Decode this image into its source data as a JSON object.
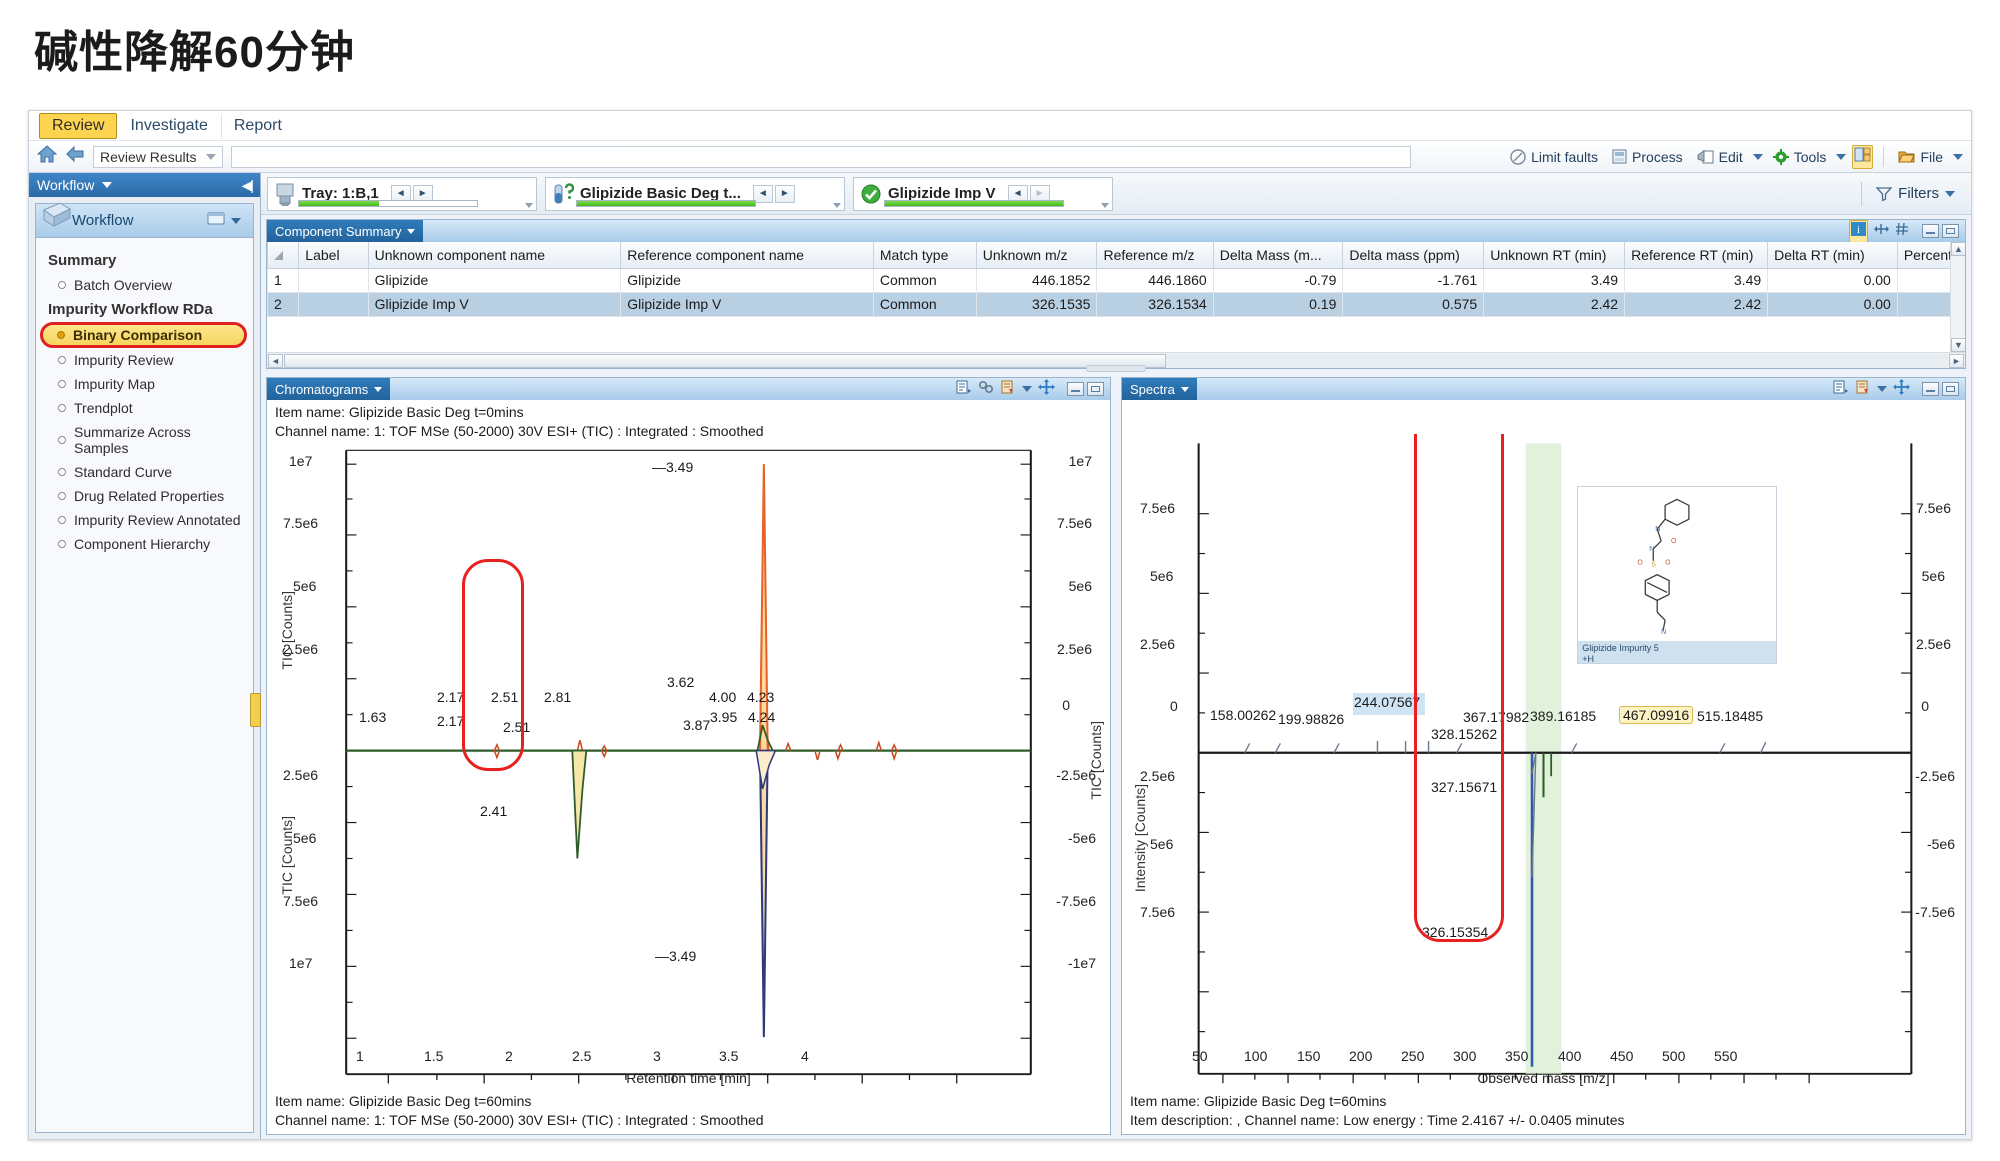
{
  "slide": {
    "title": "碱性降解60分钟"
  },
  "ribbon": {
    "tabs": [
      {
        "label": "Review",
        "active": true
      },
      {
        "label": "Investigate",
        "active": false
      },
      {
        "label": "Report",
        "active": false
      }
    ]
  },
  "toolbar": {
    "home_icon": "home-icon",
    "back_icon": "back-arrow-icon",
    "breadcrumb": "Review Results",
    "items": [
      {
        "label": "Limit faults",
        "icon": "limit-faults-icon",
        "caret": false
      },
      {
        "label": "Process",
        "icon": "process-icon",
        "caret": false
      },
      {
        "label": "Edit",
        "icon": "edit-icon",
        "caret": true
      },
      {
        "label": "Tools",
        "icon": "gear-icon",
        "caret": true
      },
      {
        "label": "File",
        "icon": "folder-icon",
        "caret": true
      }
    ]
  },
  "sidebar": {
    "header": "Workflow",
    "card_title": "Workflow",
    "groups": [
      {
        "title": "Summary",
        "items": [
          {
            "label": "Batch Overview",
            "selected": false
          }
        ]
      },
      {
        "title": "Impurity Workflow RDa",
        "items": [
          {
            "label": "Binary Comparison",
            "selected": true
          },
          {
            "label": "Impurity Review",
            "selected": false
          },
          {
            "label": "Impurity Map",
            "selected": false
          },
          {
            "label": "Trendplot",
            "selected": false
          },
          {
            "label": "Summarize Across Samples",
            "selected": false
          },
          {
            "label": "Standard Curve",
            "selected": false
          },
          {
            "label": "Drug Related Properties",
            "selected": false
          },
          {
            "label": "Impurity Review Annotated",
            "selected": false
          },
          {
            "label": "Component Hierarchy",
            "selected": false
          }
        ]
      }
    ]
  },
  "navbar": {
    "boxes": [
      {
        "title": "Tray: 1:B,1",
        "icon": "tray-icon",
        "progress": 45
      },
      {
        "title": "Glipizide Basic Deg t...",
        "icon": "sample-icon",
        "progress": 100
      },
      {
        "title": "Glipizide Imp V",
        "icon": "check-icon",
        "progress": 100
      }
    ],
    "filters_label": "Filters",
    "filters_icon": "funnel-icon"
  },
  "component_summary": {
    "title": "Component Summary",
    "columns": [
      "Label",
      "Unknown component name",
      "Reference component name",
      "Match type",
      "Unknown m/z",
      "Reference m/z",
      "Delta Mass (m...",
      "Delta mass (ppm)",
      "Unknown RT (min)",
      "Reference RT (min)",
      "Delta RT (min)",
      "Percent"
    ],
    "rows": [
      {
        "index": "1",
        "selected": false,
        "cells": [
          "",
          "Glipizide",
          "Glipizide",
          "Common",
          "446.1852",
          "446.1860",
          "-0.79",
          "-1.761",
          "3.49",
          "3.49",
          "0.00",
          ""
        ]
      },
      {
        "index": "2",
        "selected": true,
        "cells": [
          "",
          "Glipizide Imp V",
          "Glipizide Imp V",
          "Common",
          "326.1535",
          "326.1534",
          "0.19",
          "0.575",
          "2.42",
          "2.42",
          "0.00",
          ""
        ]
      }
    ]
  },
  "chart_data": [
    {
      "type": "line",
      "panel_title": "Chromatograms",
      "header_lines": [
        "Item name: Glipizide Basic Deg t=0mins",
        "Channel name: 1: TOF MSe (50-2000) 30V ESI+ (TIC) : Integrated : Smoothed"
      ],
      "footer_lines": [
        "Item name: Glipizide Basic Deg t=60mins",
        "Channel name: 1: TOF MSe (50-2000) 30V ESI+ (TIC) : Integrated : Smoothed"
      ],
      "xlabel": "Retention time [min]",
      "ylabel": "TIC [Counts]",
      "ylabel_right": "TIC [Counts]",
      "xticks": [
        "1",
        "1.5",
        "2",
        "2.5",
        "3",
        "3.5",
        "4"
      ],
      "xlim": [
        0.78,
        4.42
      ],
      "yticks_upper": [
        "1e7",
        "7.5e6",
        "5e6",
        "2.5e6"
      ],
      "yticks_lower": [
        "2.5e6",
        "5e6",
        "7.5e6",
        "1e7"
      ],
      "yticks_right_upper": [
        "1e7",
        "7.5e6",
        "5e6",
        "2.5e6",
        "0"
      ],
      "yticks_right_lower": [
        "-2.5e6",
        "-5e6",
        "-7.5e6",
        "-1e7"
      ],
      "zero_label": "0",
      "mirrored": true,
      "grid": false,
      "upper_peaks": [
        {
          "rt": 1.63,
          "label": "1.63",
          "height": 0.004
        },
        {
          "rt": 2.17,
          "label": "2.17",
          "height": 0.006
        },
        {
          "rt": 2.51,
          "label": "2.51",
          "height": 0.008
        },
        {
          "rt": 2.81,
          "label": "2.81",
          "height": 0.004
        },
        {
          "rt": 3.49,
          "label": "3.49",
          "height": 1.0
        },
        {
          "rt": 3.62,
          "label": "3.62",
          "height": 0.02
        },
        {
          "rt": 4.0,
          "label": "4.00",
          "height": 0.01
        },
        {
          "rt": 4.23,
          "label": "4.23",
          "height": 0.01
        }
      ],
      "lower_peaks": [
        {
          "rt": 2.17,
          "label": "2.17",
          "height": 0.006
        },
        {
          "rt": 2.41,
          "label": "2.41",
          "height": 0.26
        },
        {
          "rt": 2.51,
          "label": "2.51",
          "height": 0.02
        },
        {
          "rt": 3.49,
          "label": "3.49",
          "height": 1.0
        },
        {
          "rt": 3.87,
          "label": "3.87",
          "height": 0.01
        },
        {
          "rt": 3.95,
          "label": "3.95",
          "height": 0.01
        },
        {
          "rt": 4.24,
          "label": "4.24",
          "height": 0.01
        }
      ],
      "annotation": {
        "type": "red-rounded-rect",
        "note": "highlights 2.41 min peak region"
      }
    },
    {
      "type": "line",
      "panel_title": "Spectra",
      "footer_lines": [
        "Item name: Glipizide Basic Deg t=60mins",
        "Item description: , Channel name: Low energy : Time 2.4167 +/- 0.0405 minutes"
      ],
      "xlabel": "Observed mass [m/z]",
      "ylabel": "Intensity [Counts]",
      "xticks": [
        "50",
        "100",
        "150",
        "200",
        "250",
        "300",
        "350",
        "400",
        "450",
        "500",
        "550"
      ],
      "xlim": [
        35,
        575
      ],
      "yticks_upper": [
        "7.5e6",
        "5e6",
        "2.5e6"
      ],
      "yticks_lower": [
        "2.5e6",
        "5e6",
        "7.5e6"
      ],
      "yticks_right_upper": [
        "7.5e6",
        "5e6",
        "2.5e6"
      ],
      "yticks_right_lower": [
        "-2.5e6",
        "-5e6",
        "-7.5e6"
      ],
      "zero_label": "0",
      "mirrored": true,
      "grid": false,
      "upper_masses": [
        {
          "mz": 158.00262,
          "label": "158.00262",
          "highlight": "none"
        },
        {
          "mz": 199.98826,
          "label": "199.98826",
          "highlight": "none"
        },
        {
          "mz": 244.07567,
          "label": "244.07567",
          "highlight": "blue"
        },
        {
          "mz": 367.17982,
          "label": "367.17982",
          "highlight": "green"
        },
        {
          "mz": 389.16185,
          "label": "389.16185",
          "highlight": "none"
        },
        {
          "mz": 467.09916,
          "label": "467.09916",
          "highlight": "yellow"
        },
        {
          "mz": 515.18485,
          "label": "515.18485",
          "highlight": "none"
        }
      ],
      "lower_masses": [
        {
          "mz": 326.15354,
          "label": "326.15354",
          "highlight": "green"
        },
        {
          "mz": 327.15671,
          "label": "327.15671",
          "highlight": "green"
        },
        {
          "mz": 328.15262,
          "label": "328.15262",
          "highlight": "green"
        }
      ],
      "structure": {
        "name": "Glipizide Impurity 5",
        "adduct": "+H"
      },
      "annotation": {
        "type": "red-rounded-rect",
        "note": "highlights 326.15354 m/z region"
      }
    }
  ],
  "colors": {
    "accent": "#2a6ba8",
    "highlight_yellow": "#fcd450",
    "selection_red": "#e82020",
    "row_selected": "#b9cfe2",
    "trace_green": "#2f5d2a",
    "trace_orange": "#e8622a",
    "trace_navy": "#2e3a7a"
  }
}
